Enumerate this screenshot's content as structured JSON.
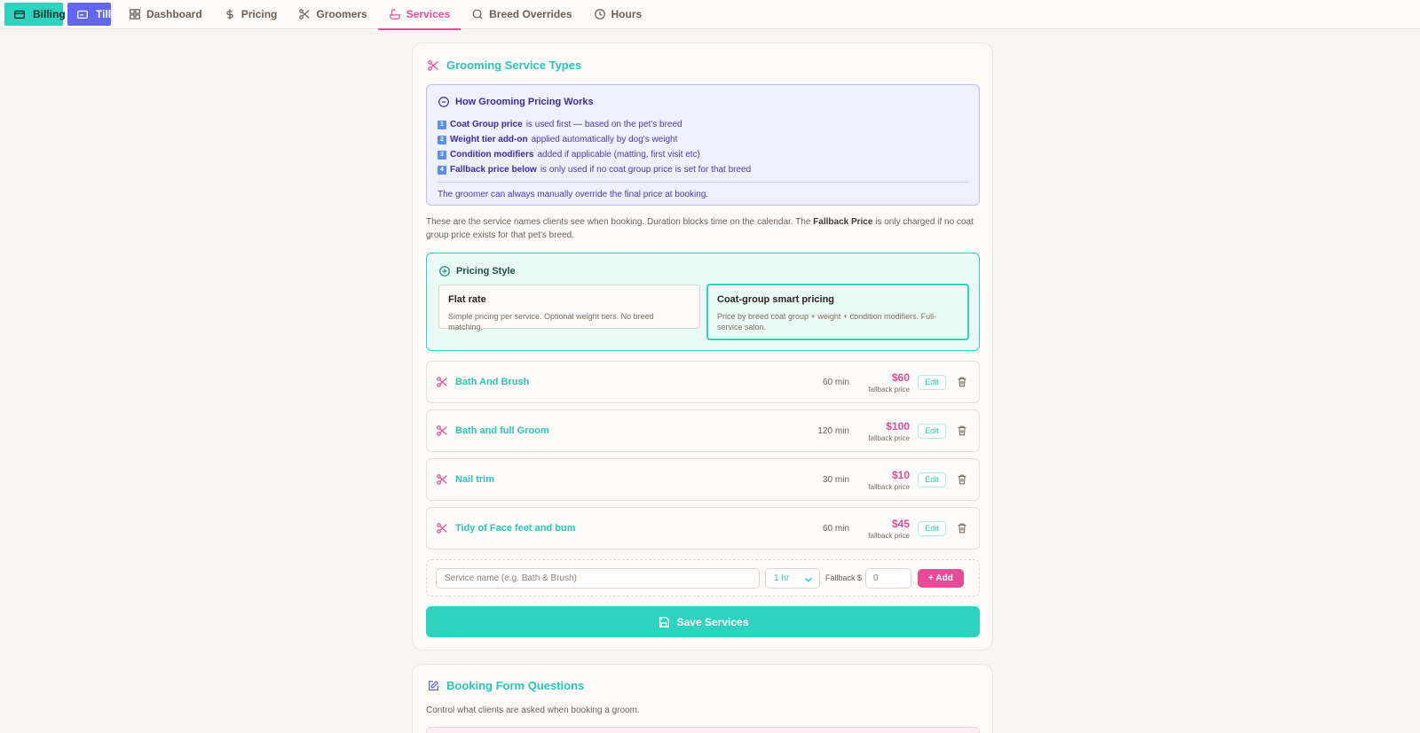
{
  "nav": {
    "billing": "Billing",
    "till": "Till",
    "tabs": [
      {
        "label": "Dashboard",
        "icon": "grid-icon"
      },
      {
        "label": "Pricing",
        "icon": "dollar-icon"
      },
      {
        "label": "Groomers",
        "icon": "scissors-icon"
      },
      {
        "label": "Services",
        "icon": "bath-icon",
        "active": true
      },
      {
        "label": "Breed Overrides",
        "icon": "search-icon"
      },
      {
        "label": "Hours",
        "icon": "clock-icon"
      }
    ]
  },
  "grooming": {
    "title": "Grooming Service Types",
    "info": {
      "title": "How Grooming Pricing Works",
      "steps": [
        {
          "num": "1",
          "bold": "Coat Group price",
          "text": "is used first — based on the pet's breed"
        },
        {
          "num": "2",
          "bold": "Weight tier add-on",
          "text": "applied automatically by dog's weight"
        },
        {
          "num": "3",
          "bold": "Condition modifiers",
          "text": "added if applicable (matting, first visit etc)"
        },
        {
          "num": "4",
          "bold": "Fallback price below",
          "text": "is only used if no coat group price is set for that breed"
        }
      ],
      "footer": "The groomer can always manually override the final price at booking."
    },
    "description_pre": "These are the service names clients see when booking. Duration blocks time on the calendar. The",
    "description_bold": "Fallback Price",
    "description_post": "is only charged if no coat group price exists for that pet's breed.",
    "pricing_style": {
      "title": "Pricing Style",
      "options": [
        {
          "title": "Flat rate",
          "sub": "Simple pricing per service. Optional weight tiers. No breed matching.",
          "selected": false
        },
        {
          "title": "Coat-group smart pricing",
          "sub": "Price by breed coat group + weight + condition modifiers. Full-service salon.",
          "selected": true
        }
      ]
    },
    "services": [
      {
        "name": "Bath And Brush",
        "duration": "60 min",
        "price": "$60",
        "price_note": "fallback price",
        "edit": "Edit"
      },
      {
        "name": "Bath and full Groom",
        "duration": "120 min",
        "price": "$100",
        "price_note": "fallback price",
        "edit": "Edit"
      },
      {
        "name": "Nail trim",
        "duration": "30 min",
        "price": "$10",
        "price_note": "fallback price",
        "edit": "Edit"
      },
      {
        "name": "Tidy of Face feet and bum",
        "duration": "60 min",
        "price": "$45",
        "price_note": "fallback price",
        "edit": "Edit"
      }
    ],
    "add": {
      "name_placeholder": "Service name (e.g. Bath & Brush)",
      "duration_value": "1 hr",
      "fallback_label": "Fallback $",
      "fallback_value": "0",
      "add_label": "+ Add"
    },
    "save_label": "Save Services"
  },
  "booking_form": {
    "title": "Booking Form Questions",
    "description": "Control what clients are asked when booking a groom."
  },
  "colors": {
    "teal": "#2ed3be",
    "pink": "#e64b97",
    "indigo": "#6366f1"
  }
}
